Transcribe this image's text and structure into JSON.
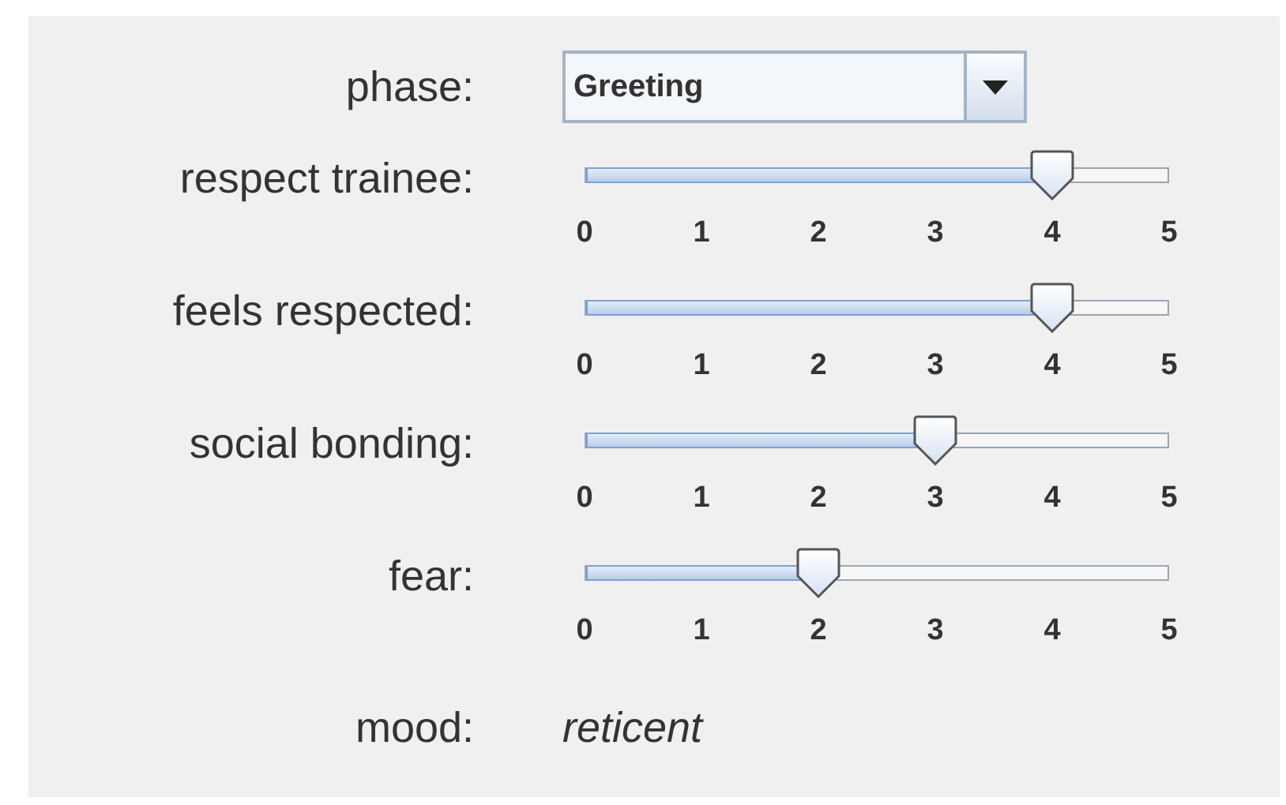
{
  "phase": {
    "label": "phase:",
    "value": "Greeting"
  },
  "sliders": [
    {
      "label": "respect trainee:",
      "level": 0.8,
      "ticks": [
        "0",
        "1",
        "2",
        "3",
        "4",
        "5"
      ]
    },
    {
      "label": "feels respected:",
      "level": 0.8,
      "ticks": [
        "0",
        "1",
        "2",
        "3",
        "4",
        "5"
      ]
    },
    {
      "label": "social bonding:",
      "level": 0.6,
      "ticks": [
        "0",
        "1",
        "2",
        "3",
        "4",
        "5"
      ]
    },
    {
      "label": "fear:",
      "level": 0.4,
      "ticks": [
        "0",
        "1",
        "2",
        "3",
        "4",
        "5"
      ]
    }
  ],
  "mood": {
    "label": "mood:",
    "value": "reticent"
  }
}
